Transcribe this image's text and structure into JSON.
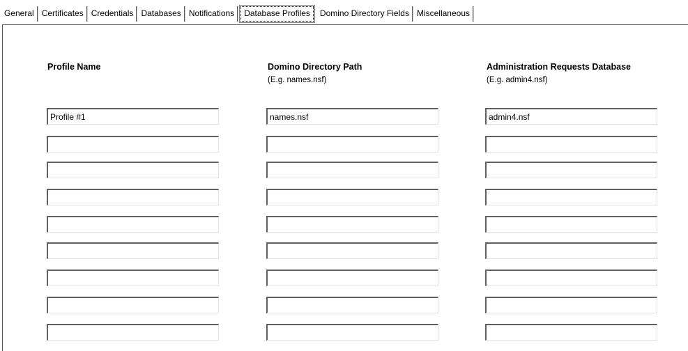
{
  "tabs": [
    {
      "label": "General",
      "selected": false
    },
    {
      "label": "Certificates",
      "selected": false
    },
    {
      "label": "Credentials",
      "selected": false
    },
    {
      "label": "Databases",
      "selected": false
    },
    {
      "label": "Notifications",
      "selected": false
    },
    {
      "label": "Database Profiles",
      "selected": true
    },
    {
      "label": "Domino Directory Fields",
      "selected": false
    },
    {
      "label": "Miscellaneous",
      "selected": false
    }
  ],
  "columns": {
    "profile_name": {
      "header": "Profile Name"
    },
    "directory_path": {
      "header": "Domino Directory Path",
      "hint": "(E.g. names.nsf)"
    },
    "admin_requests": {
      "header": "Administration Requests Database",
      "hint": "(E.g. admin4.nsf)"
    }
  },
  "rows": [
    {
      "profile_name": "Profile #1",
      "directory_path": "names.nsf",
      "admin_requests": "admin4.nsf"
    },
    {
      "profile_name": "",
      "directory_path": "",
      "admin_requests": ""
    },
    {
      "profile_name": "",
      "directory_path": "",
      "admin_requests": ""
    },
    {
      "profile_name": "",
      "directory_path": "",
      "admin_requests": ""
    },
    {
      "profile_name": "",
      "directory_path": "",
      "admin_requests": ""
    },
    {
      "profile_name": "",
      "directory_path": "",
      "admin_requests": ""
    },
    {
      "profile_name": "",
      "directory_path": "",
      "admin_requests": ""
    },
    {
      "profile_name": "",
      "directory_path": "",
      "admin_requests": ""
    },
    {
      "profile_name": "",
      "directory_path": "",
      "admin_requests": ""
    }
  ]
}
